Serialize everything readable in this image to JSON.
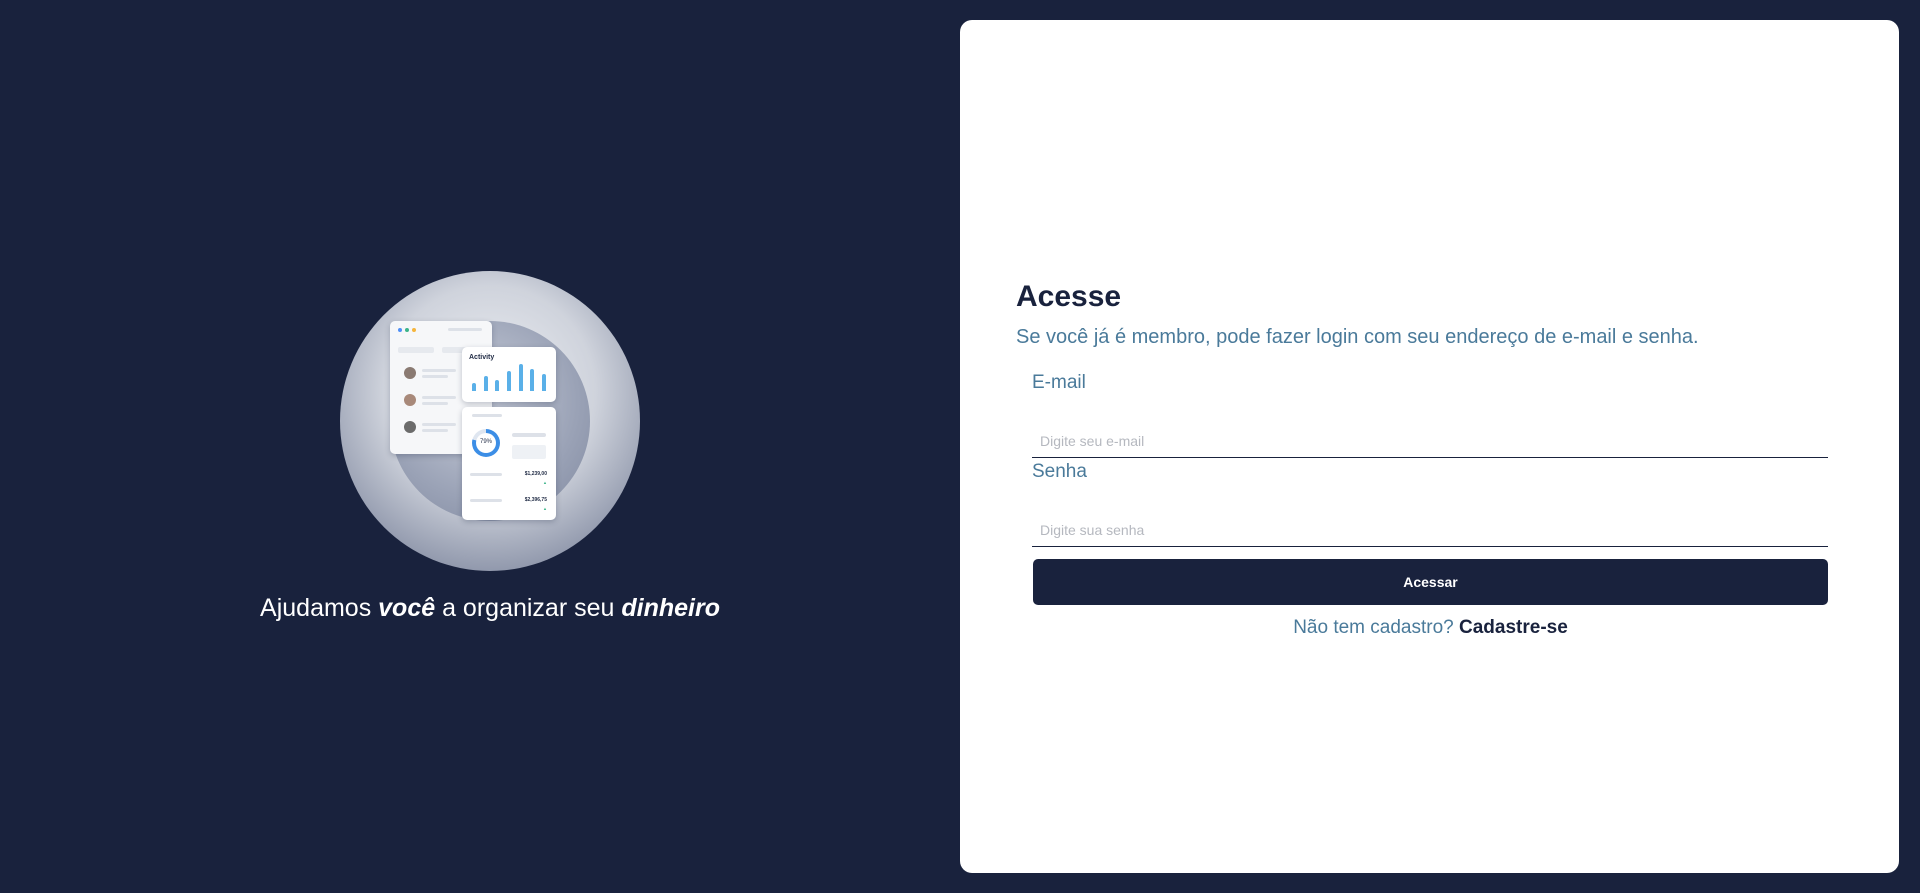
{
  "hero": {
    "text_part1": "Ajudamos ",
    "text_em1": "você",
    "text_part2": " a organizar seu ",
    "text_em2": "dinheiro",
    "illustration": {
      "activity_title": "Activity",
      "donut_label": "79%",
      "amount_1": "$1,239,00",
      "amount_2": "$2,396,75",
      "window_dot_colors": [
        "#4f8ff7",
        "#3bb48a",
        "#f5b53d"
      ],
      "bar_levels": [
        0.3,
        0.55,
        0.4,
        0.7,
        0.95,
        0.8,
        0.6
      ]
    }
  },
  "login": {
    "title": "Acesse",
    "subtitle": "Se você já é membro, pode fazer login com seu endereço de e-mail e senha.",
    "email": {
      "label": "E-mail",
      "placeholder": "Digite seu e-mail",
      "value": ""
    },
    "password": {
      "label": "Senha",
      "placeholder": "Digite sua senha",
      "value": ""
    },
    "submit_label": "Acessar",
    "signup_question": "Não tem cadastro?",
    "signup_link": "Cadastre-se"
  },
  "colors": {
    "background": "#19223d",
    "panel": "#ffffff",
    "accent_text": "#4a7a9a",
    "primary": "#19223d"
  }
}
